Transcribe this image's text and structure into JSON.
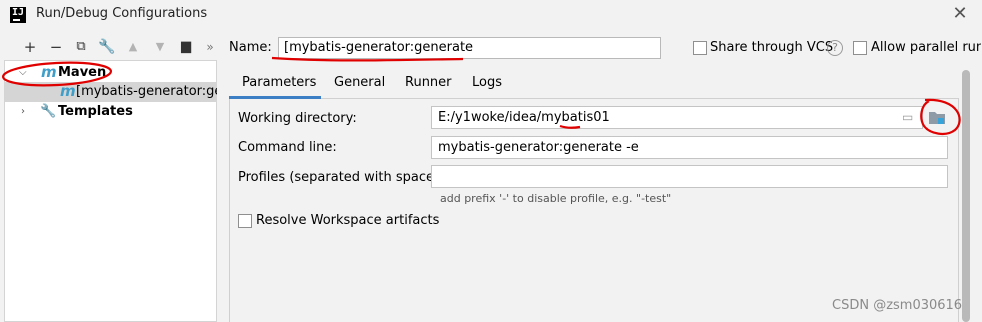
{
  "window": {
    "title": "Run/Debug Configurations"
  },
  "tree": {
    "items": [
      {
        "label": "Maven"
      },
      {
        "label": "[mybatis-generator:generate"
      },
      {
        "label": "Templates"
      }
    ]
  },
  "name": {
    "label": "Name:",
    "value": "[mybatis-generator:generate"
  },
  "options": {
    "share_label": "Share through VCS",
    "parallel_label": "Allow parallel run"
  },
  "tabs": [
    "Parameters",
    "General",
    "Runner",
    "Logs"
  ],
  "form": {
    "working_dir_label": "Working directory:",
    "working_dir_value": "E:/y1woke/idea/mybatis01",
    "command_line_label": "Command line:",
    "command_line_value": "mybatis-generator:generate -e",
    "profiles_label": "Profiles (separated with space):",
    "profiles_value": "",
    "profiles_hint": "add prefix '-' to disable profile, e.g. \"-test\"",
    "resolve_label": "Resolve Workspace artifacts"
  },
  "watermark": "CSDN @zsm030616",
  "colors": {
    "accent": "#3d7fc4",
    "maven_icon": "#3f9fc9",
    "annotation": "#e00000"
  }
}
